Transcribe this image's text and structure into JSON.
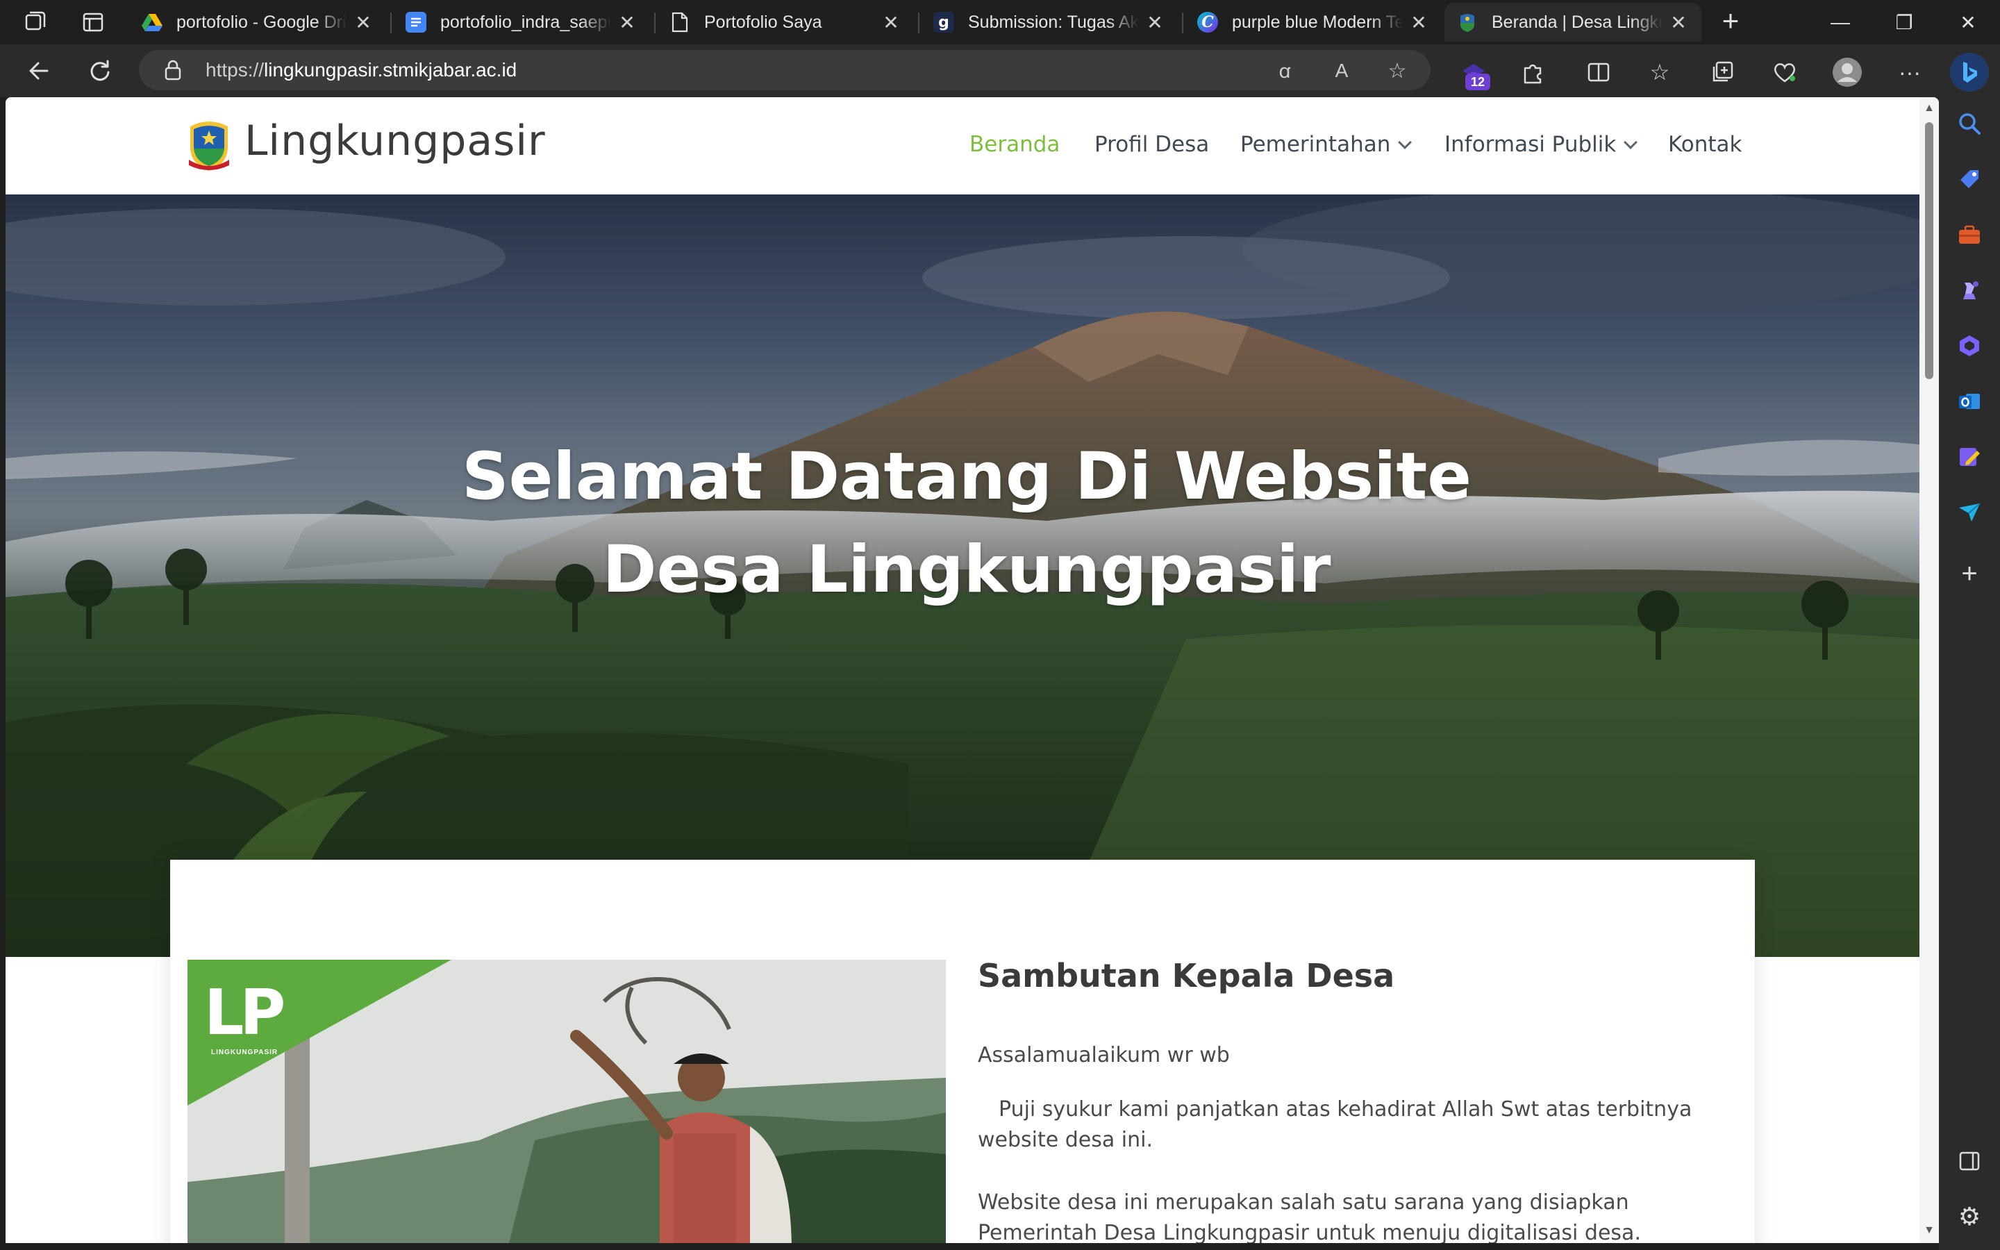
{
  "browser": {
    "tabs": [
      {
        "title": "portofolio - Google Drive",
        "favicon": "google-drive-icon",
        "color": "#34a853"
      },
      {
        "title": "portofolio_indra_saepudin",
        "favicon": "google-docs-icon",
        "color": "#4285f4"
      },
      {
        "title": "Portofolio Saya",
        "favicon": "document-icon",
        "color": "#ffffff"
      },
      {
        "title": "Submission: Tugas Akhir",
        "favicon": "g-letter-icon",
        "color": "#ffffff"
      },
      {
        "title": "purple blue Modern Tech",
        "favicon": "canva-icon",
        "color": "#6a4cff"
      },
      {
        "title": "Beranda | Desa Lingkungpasir",
        "favicon": "village-emblem-icon",
        "color": "#2b6cb0"
      }
    ],
    "url_prefix": "https://",
    "url_host": "lingkungpasir.stmikjabar.ac.id",
    "extension_badge": "12",
    "window_controls": {
      "minimize": "—",
      "restore": "❐",
      "close": "✕"
    }
  },
  "site": {
    "brand": "Lingkungpasir",
    "nav": [
      {
        "label": "Beranda",
        "active": true
      },
      {
        "label": "Profil Desa",
        "active": false
      },
      {
        "label": "Pemerintahan",
        "active": false,
        "dropdown": true
      },
      {
        "label": "Informasi Publik",
        "active": false,
        "dropdown": true
      },
      {
        "label": "Kontak",
        "active": false
      }
    ],
    "accent_color": "#7cbf3f"
  },
  "hero": {
    "line1": "Selamat Datang Di Website",
    "line2": "Desa Lingkungpasir"
  },
  "welcome": {
    "title": "Sambutan Kepala Desa",
    "greeting": "Assalamualaikum wr wb",
    "para1": "Puji syukur kami panjatkan atas kehadirat Allah Swt atas terbitnya website desa ini.",
    "para2": "Website desa ini merupakan salah satu sarana yang disiapkan Pemerintah Desa Lingkungpasir untuk menuju digitalisasi desa.",
    "photo_logo": "LP",
    "photo_caption": "LINGKUNGPASIR"
  }
}
